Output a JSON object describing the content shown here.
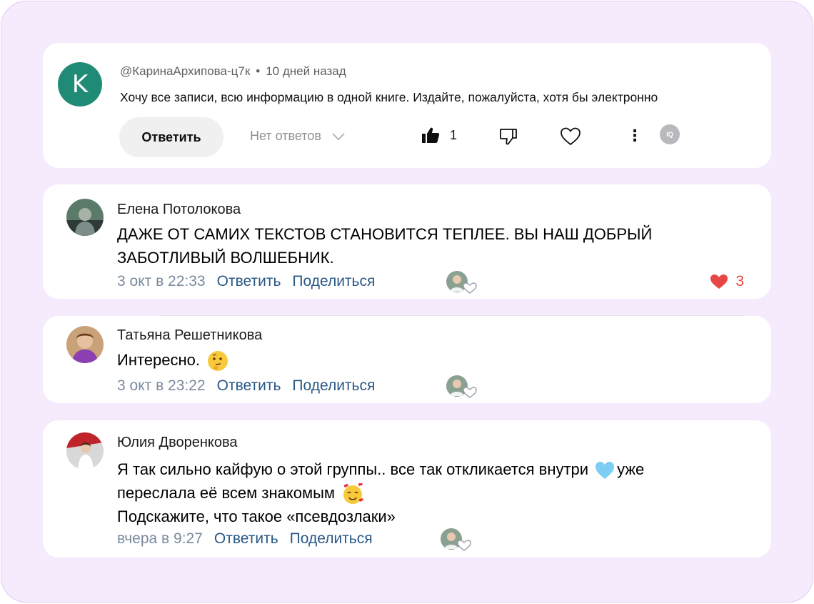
{
  "youtube_comment": {
    "avatar_letter": "K",
    "avatar_color": "#1f8a76",
    "author": "@КаринаАрхипова-ц7к",
    "separator": "•",
    "time": "10 дней назад",
    "text": "Хочу все записи, всю информацию в одной книге. Издайте, пожалуйста, хотя бы электронно",
    "reply_label": "Ответить",
    "no_replies_label": "Нет ответов",
    "like_count": "1",
    "badge_text": "IQ"
  },
  "vk_comments": [
    {
      "author": "Елена Потолокова",
      "text_lines": [
        "ДАЖЕ ОТ САМИХ ТЕКСТОВ СТАНОВИТСЯ ТЕПЛЕЕ. ВЫ НАШ ДОБРЫЙ",
        "ЗАБОТЛИВЫЙ ВОЛШЕБНИК."
      ],
      "time": "3 окт в 22:33",
      "reply_label": "Ответить",
      "share_label": "Поделиться",
      "like_count": "3"
    },
    {
      "author": "Татьяна Решетникова",
      "text_lines": [
        "Интересно."
      ],
      "time": "3 окт в 23:22",
      "reply_label": "Ответить",
      "share_label": "Поделиться"
    },
    {
      "author": "Юлия Дворенкова",
      "text_lines": [
        "Я так сильно кайфую о этой группы.. все так откликается внутри",
        "уже",
        "переслала её всем знакомым",
        "Подскажите, что такое «псевдозлаки»"
      ],
      "time": "вчера в 9:27",
      "reply_label": "Ответить",
      "share_label": "Поделиться"
    }
  ],
  "colors": {
    "frame_bg": "#f6eafd",
    "vk_link": "#2a5885",
    "vk_time": "#7a8a9e",
    "like_red": "#e64646"
  }
}
